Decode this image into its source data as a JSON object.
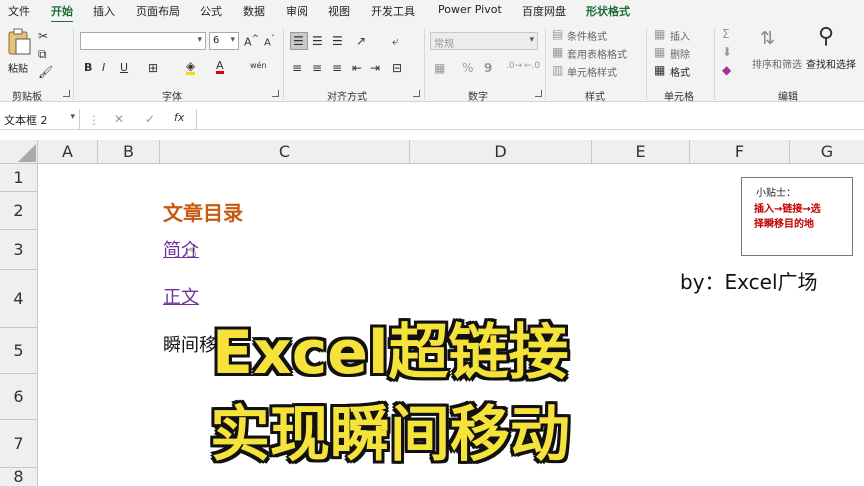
{
  "menu": {
    "tabs": [
      "文件",
      "开始",
      "插入",
      "页面布局",
      "公式",
      "数据",
      "审阅",
      "视图",
      "开发工具",
      "Power Pivot",
      "百度网盘",
      "形状格式"
    ],
    "active_tab": "开始"
  },
  "ribbon": {
    "clipboard": {
      "paste_label": "粘贴",
      "group_label": "剪贴板"
    },
    "font": {
      "font_name": "",
      "font_size": "6",
      "bold": "B",
      "italic": "I",
      "underline": "U",
      "group_label": "字体"
    },
    "alignment": {
      "group_label": "对齐方式"
    },
    "number": {
      "format": "常规",
      "percent": "%",
      "comma": "9",
      "group_label": "数字"
    },
    "styles": {
      "conditional": "条件格式",
      "table": "套用表格格式",
      "cell_styles": "单元格样式",
      "group_label": "样式"
    },
    "cells": {
      "insert": "插入",
      "delete": "删除",
      "format": "格式",
      "group_label": "单元格"
    },
    "editing": {
      "sort_filter": "排序和筛选",
      "find_select": "查找和选择",
      "group_label": "编辑"
    }
  },
  "formula_bar": {
    "name_box": "文本框 2",
    "fx": "fx",
    "value": ""
  },
  "sheet": {
    "columns": [
      "A",
      "B",
      "C",
      "D",
      "E",
      "F",
      "G"
    ],
    "rows": [
      "1",
      "2",
      "3",
      "4",
      "5",
      "6",
      "7",
      "8"
    ],
    "cells": {
      "toc_title": "文章目录",
      "link_intro": "简介",
      "link_body": "正文",
      "row5_text": "瞬间移",
      "byline": "by：Excel广场"
    },
    "tip": {
      "title": "小贴士：",
      "body_line1": "插入→链接→选",
      "body_line2": "择瞬移目的地"
    }
  },
  "overlay": {
    "line1": "Excel超链接",
    "line2": "实现瞬间移动"
  },
  "colors": {
    "accent_green": "#1e6e3a",
    "title_orange": "#c55a11",
    "link_purple": "#7030a0",
    "tip_red": "#c00000",
    "overlay_yellow": "#f5e23a"
  }
}
